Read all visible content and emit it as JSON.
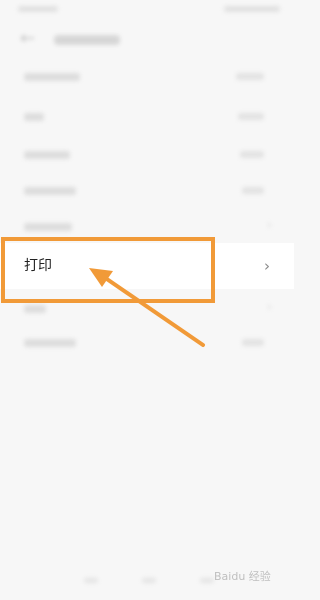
{
  "focused_item": {
    "label": "打印",
    "chevron": "›"
  },
  "background": {
    "back_glyph": "←",
    "row_chevron": "›"
  },
  "watermark": {
    "text": "Baidu 经验"
  },
  "colors": {
    "annotation": "#f19a38",
    "background": "#f7f7f7"
  }
}
